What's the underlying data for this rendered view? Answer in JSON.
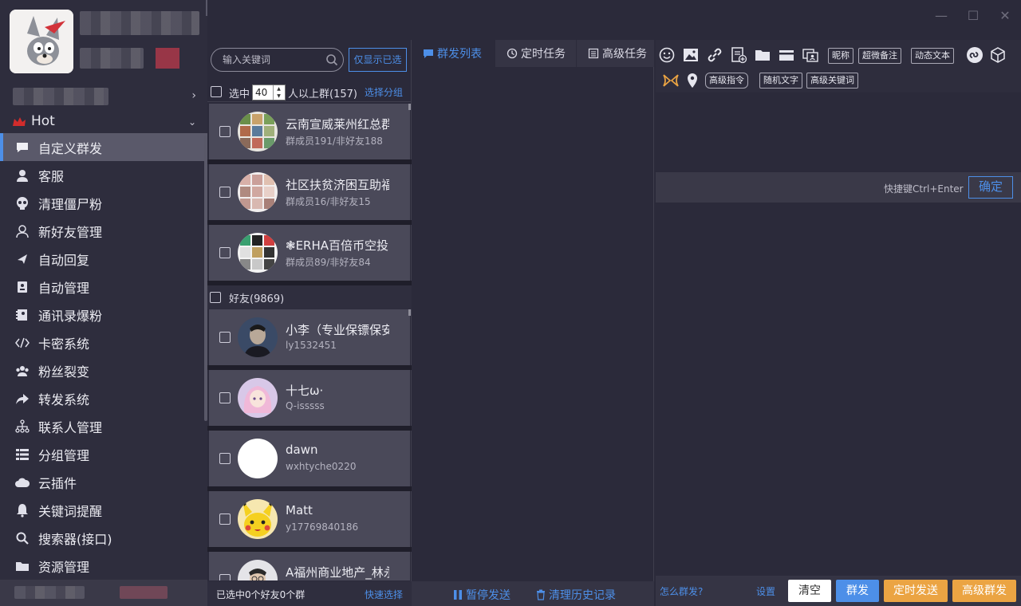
{
  "window": {
    "minimize": "—",
    "maximize": "☐",
    "close": "✕"
  },
  "sidebar": {
    "hot_label": "Hot",
    "items": [
      {
        "label": "自定义群发",
        "icon": "chat-bubble-icon",
        "active": true
      },
      {
        "label": "客服",
        "icon": "customer-service-icon"
      },
      {
        "label": "清理僵尸粉",
        "icon": "skull-icon"
      },
      {
        "label": "新好友管理",
        "icon": "user-icon"
      },
      {
        "label": "自动回复",
        "icon": "send-arrow-icon"
      },
      {
        "label": "自动管理",
        "icon": "contact-card-icon"
      },
      {
        "label": "通讯录爆粉",
        "icon": "address-book-icon"
      },
      {
        "label": "卡密系统",
        "icon": "code-icon"
      },
      {
        "label": "粉丝裂变",
        "icon": "group-icon"
      },
      {
        "label": "转发系统",
        "icon": "forward-icon"
      },
      {
        "label": "联系人管理",
        "icon": "hierarchy-icon"
      },
      {
        "label": "分组管理",
        "icon": "list-icon"
      },
      {
        "label": "云插件",
        "icon": "cloud-icon"
      },
      {
        "label": "关键词提醒",
        "icon": "bell-icon"
      },
      {
        "label": "搜索器(接口)",
        "icon": "search-icon"
      },
      {
        "label": "资源管理",
        "icon": "folder-icon"
      }
    ]
  },
  "list_panel": {
    "search_placeholder": "输入关键词",
    "only_selected": "仅显示已选",
    "select_label": "选中",
    "select_count": "40",
    "above_groups": "人以上群(157)",
    "select_group": "选择分组",
    "groups": [
      {
        "name": "云南宣威莱州红总群",
        "sub": "群成员191/非好友188"
      },
      {
        "name": "社区扶贫济困互助福",
        "sub": "群成员16/非好友15"
      },
      {
        "name": "❃ERHA百倍币空投",
        "sub": "群成员89/非好友84"
      }
    ],
    "friends_header": "好友(9869)",
    "friends": [
      {
        "name": "小李（专业保镖保安",
        "sub": "ly1532451"
      },
      {
        "name": "十七ω·",
        "sub": "Q-isssss"
      },
      {
        "name": "dawn",
        "sub": "wxhtyche0220"
      },
      {
        "name": "Matt",
        "sub": "y17769840186"
      },
      {
        "name": "A福州商业地产_林永",
        "sub": ""
      }
    ],
    "footer_status": "已选中0个好友0个群",
    "footer_quick": "快速选择"
  },
  "middle_panel": {
    "tabs": [
      "群发列表",
      "定时任务",
      "高级任务"
    ],
    "pause": "暂停发送",
    "clear_history": "清理历史记录"
  },
  "editor": {
    "tags": [
      "昵称",
      "超微备注",
      "动态文本",
      "高级指令",
      "随机文字",
      "高级关键词"
    ],
    "hint": "快捷键Ctrl+Enter",
    "confirm": "确定",
    "how": "怎么群发?",
    "settings": "设置",
    "clear": "清空",
    "send": "群发",
    "timed_send": "定时发送",
    "advanced_send": "高级群发"
  },
  "colors": {
    "accent": "#4d8fe8",
    "orange": "#eba443",
    "bg": "#2b2a3a",
    "card": "#4a4959"
  }
}
